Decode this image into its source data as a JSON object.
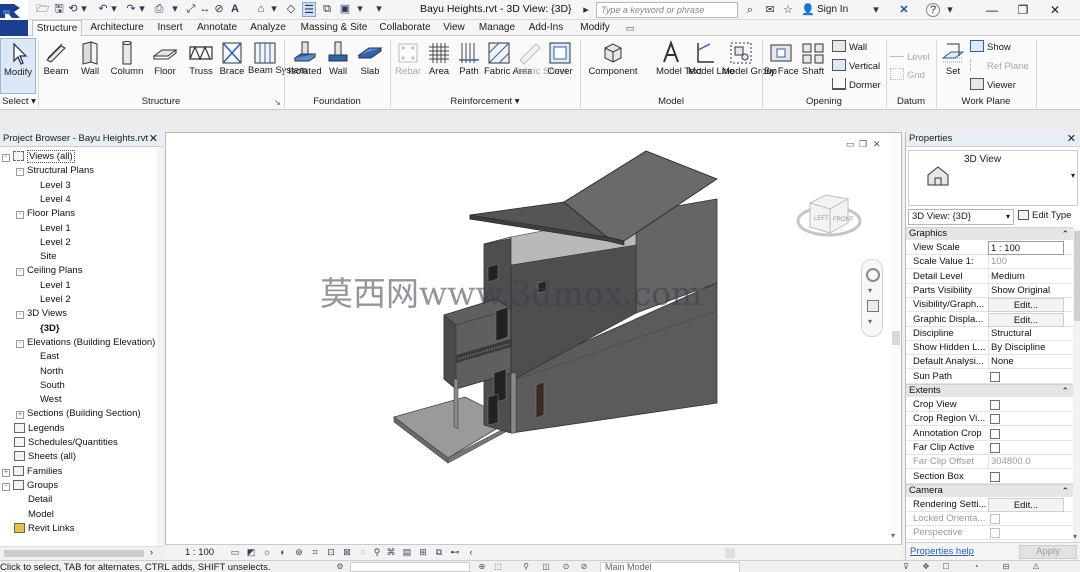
{
  "title_bar": {
    "document_title": "Bayu Heights.rvt - 3D View: {3D}",
    "search_placeholder": "Type a keyword or phrase",
    "sign_in": "Sign In",
    "help": "?",
    "logo_icon": "revit-r-logo-icon",
    "qat_icons": [
      "open-icon",
      "save-icon",
      "sync-icon",
      "undo-icon",
      "redo-icon",
      "print-icon",
      "measure-icon",
      "dimension-icon",
      "tag-icon",
      "text-icon",
      "3d-view-icon",
      "section-icon",
      "thin-lines-icon",
      "close-hidden-icon",
      "switch-windows-icon",
      "qat-dropdown-icon"
    ]
  },
  "tabs": [
    "Structure",
    "Architecture",
    "Insert",
    "Annotate",
    "Analyze",
    "Massing & Site",
    "Collaborate",
    "View",
    "Manage",
    "Add-Ins",
    "Modify"
  ],
  "active_tab": "Structure",
  "ribbon": {
    "select": {
      "modify": "Modify",
      "title": "Select"
    },
    "structure": {
      "title": "Structure",
      "items": [
        "Beam",
        "Wall",
        "Column",
        "Floor",
        "Truss",
        "Brace",
        "Beam System"
      ]
    },
    "foundation": {
      "title": "Foundation",
      "items": [
        "Isolated",
        "Wall",
        "Slab"
      ]
    },
    "reinforcement": {
      "title": "Reinforcement",
      "items": [
        "Rebar",
        "Area",
        "Path",
        "Fabric Area",
        "Fabric Sheet",
        "Cover"
      ]
    },
    "model": {
      "title": "Model",
      "items": [
        "Component",
        "Model Text",
        "Model Line",
        "Model Group"
      ]
    },
    "opening": {
      "title": "Opening",
      "items": [
        "By Face",
        "Shaft"
      ],
      "small": [
        "Wall",
        "Vertical",
        "Dormer"
      ]
    },
    "datum": {
      "title": "Datum",
      "small": [
        "Level",
        "Grid"
      ]
    },
    "work_plane": {
      "title": "Work Plane",
      "set": "Set",
      "small": [
        "Show",
        "Ref Plane",
        "Viewer"
      ]
    }
  },
  "project_browser": {
    "title": "Project Browser - Bayu Heights.rvt",
    "tree": [
      {
        "label": "Views (all)",
        "level": 0,
        "toggle": "-",
        "icon": "views-icon"
      },
      {
        "label": "Structural Plans",
        "level": 1,
        "toggle": "-"
      },
      {
        "label": "Level 3",
        "level": 2
      },
      {
        "label": "Level 4",
        "level": 2
      },
      {
        "label": "Floor Plans",
        "level": 1,
        "toggle": "-"
      },
      {
        "label": "Level 1",
        "level": 2
      },
      {
        "label": "Level 2",
        "level": 2
      },
      {
        "label": "Site",
        "level": 2
      },
      {
        "label": "Ceiling Plans",
        "level": 1,
        "toggle": "-"
      },
      {
        "label": "Level 1",
        "level": 2
      },
      {
        "label": "Level 2",
        "level": 2
      },
      {
        "label": "3D Views",
        "level": 1,
        "toggle": "-"
      },
      {
        "label": "{3D}",
        "level": 2,
        "bold": true
      },
      {
        "label": "Elevations (Building Elevation)",
        "level": 1,
        "toggle": "-"
      },
      {
        "label": "East",
        "level": 2
      },
      {
        "label": "North",
        "level": 2
      },
      {
        "label": "South",
        "level": 2
      },
      {
        "label": "West",
        "level": 2
      },
      {
        "label": "Sections (Building Section)",
        "level": 1,
        "toggle": "+"
      },
      {
        "label": "Legends",
        "level": 0,
        "icon": "legends-icon"
      },
      {
        "label": "Schedules/Quantities",
        "level": 0,
        "icon": "schedules-icon"
      },
      {
        "label": "Sheets (all)",
        "level": 0,
        "icon": "sheets-icon"
      },
      {
        "label": "Families",
        "level": 0,
        "toggle": "+",
        "icon": "families-icon"
      },
      {
        "label": "Groups",
        "level": 0,
        "toggle": "-",
        "icon": "groups-icon"
      },
      {
        "label": "Detail",
        "level": 1
      },
      {
        "label": "Model",
        "level": 1
      },
      {
        "label": "Revit Links",
        "level": 0,
        "icon": "revit-links-icon"
      }
    ]
  },
  "viewport": {
    "watermark": "莫西网www.3dmox.com",
    "view_cube": {
      "left": "LEFT",
      "front": "FRONT"
    }
  },
  "view_control_bar": {
    "scale": "1 : 100"
  },
  "properties": {
    "title": "Properties",
    "type_name": "3D View",
    "type_select": "3D View: {3D}",
    "edit_type": "Edit Type",
    "groups": [
      {
        "title": "Graphics",
        "rows": [
          {
            "label": "View Scale",
            "value": "1 : 100",
            "kind": "box"
          },
          {
            "label": "Scale Value    1:",
            "value": "100",
            "kind": "grey"
          },
          {
            "label": "Detail Level",
            "value": "Medium",
            "kind": "text"
          },
          {
            "label": "Parts Visibility",
            "value": "Show Original",
            "kind": "text"
          },
          {
            "label": "Visibility/Graph...",
            "value": "Edit...",
            "kind": "btn"
          },
          {
            "label": "Graphic Displa...",
            "value": "Edit...",
            "kind": "btn"
          },
          {
            "label": "Discipline",
            "value": "Structural",
            "kind": "text"
          },
          {
            "label": "Show Hidden L...",
            "value": "By Discipline",
            "kind": "text"
          },
          {
            "label": "Default Analysi...",
            "value": "None",
            "kind": "text"
          },
          {
            "label": "Sun Path",
            "value": "",
            "kind": "check"
          }
        ]
      },
      {
        "title": "Extents",
        "rows": [
          {
            "label": "Crop View",
            "value": "",
            "kind": "check"
          },
          {
            "label": "Crop Region Vi...",
            "value": "",
            "kind": "check"
          },
          {
            "label": "Annotation Crop",
            "value": "",
            "kind": "check"
          },
          {
            "label": "Far Clip Active",
            "value": "",
            "kind": "check"
          },
          {
            "label": "Far Clip Offset",
            "value": "304800.0",
            "kind": "grey",
            "label_grey": true
          },
          {
            "label": "Section Box",
            "value": "",
            "kind": "check"
          }
        ]
      },
      {
        "title": "Camera",
        "rows": [
          {
            "label": "Rendering Setti...",
            "value": "Edit...",
            "kind": "btn"
          },
          {
            "label": "Locked Orienta...",
            "value": "",
            "kind": "checkgrey",
            "label_grey": true
          },
          {
            "label": "Perspective",
            "value": "",
            "kind": "checkgrey",
            "label_grey": true
          }
        ]
      }
    ],
    "help": "Properties help",
    "apply": "Apply"
  },
  "status_bar": {
    "text": "Click to select, TAB for alternates, CTRL adds, SHIFT unselects.",
    "model": "Main Model"
  }
}
